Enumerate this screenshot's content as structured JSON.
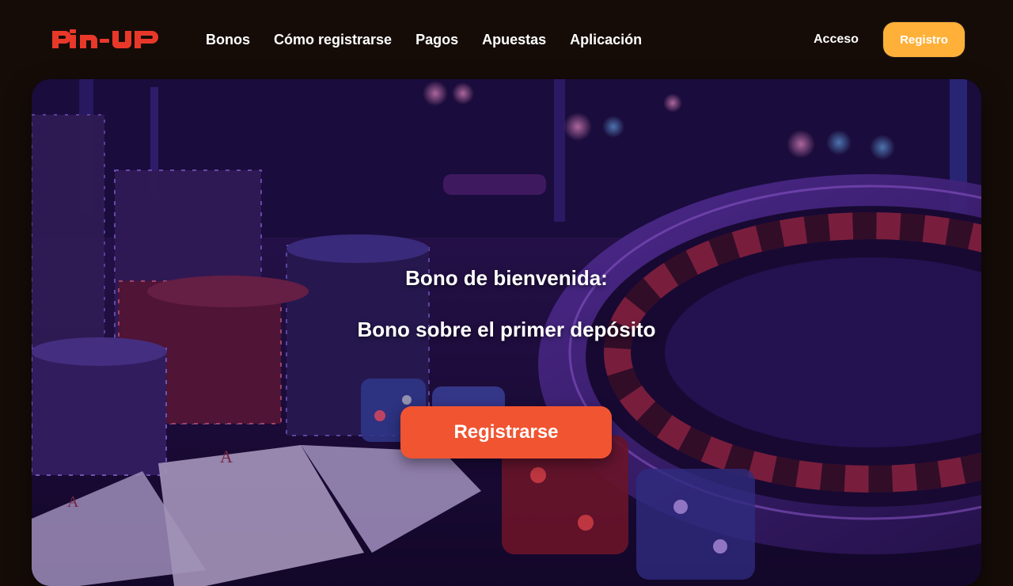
{
  "brand": {
    "logo_text": "PIN-UP",
    "logo_color": "#e8382a"
  },
  "nav": {
    "items": [
      {
        "label": "Bonos"
      },
      {
        "label": "Cómo registrarse"
      },
      {
        "label": "Pagos"
      },
      {
        "label": "Apuestas"
      },
      {
        "label": "Aplicación"
      }
    ]
  },
  "header": {
    "login_label": "Acceso",
    "signup_label": "Registro"
  },
  "hero": {
    "title": "Bono de bienvenida:",
    "subtitle": "Bono sobre el primer depósito",
    "cta_label": "Registrarse",
    "background_description_icons": [
      "casino-chips",
      "roulette-wheel",
      "playing-cards",
      "dice"
    ]
  },
  "colors": {
    "page_background": "#150c08",
    "accent_orange": "#ffb039",
    "cta_red": "#f05431",
    "brand_red": "#e8382a"
  }
}
